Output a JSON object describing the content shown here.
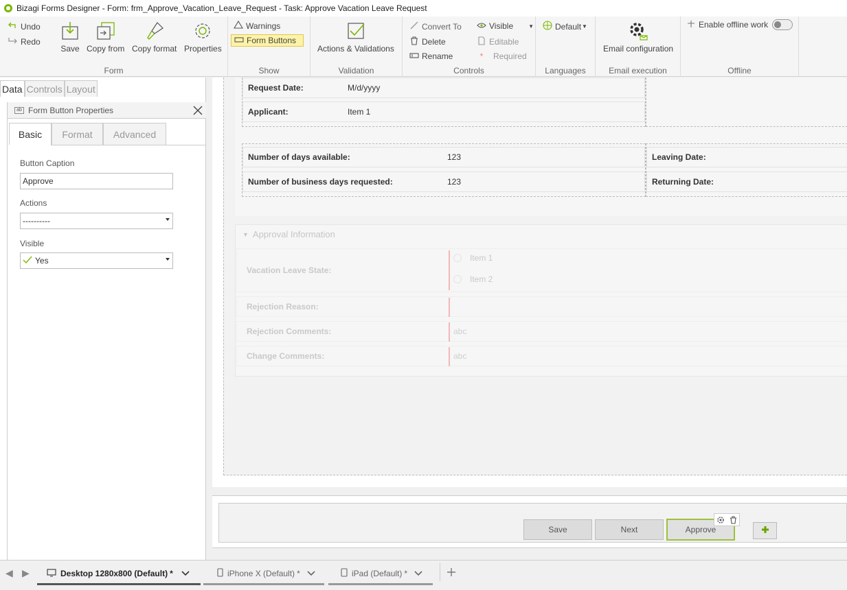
{
  "window": {
    "title": "Bizagi Forms Designer  - Form: frm_Approve_Vacation_Leave_Request - Task:  Approve Vacation Leave Request"
  },
  "ribbon": {
    "form": {
      "label": "Form",
      "undo": "Undo",
      "redo": "Redo",
      "save": "Save",
      "copy_from": "Copy from",
      "copy_format": "Copy format",
      "properties": "Properties"
    },
    "show": {
      "label": "Show",
      "warnings": "Warnings",
      "form_buttons": "Form Buttons"
    },
    "validation": {
      "label": "Validation",
      "actions": "Actions & Validations"
    },
    "controls": {
      "label": "Controls",
      "convert_to": "Convert To",
      "delete": "Delete",
      "rename": "Rename",
      "visible": "Visible",
      "editable": "Editable",
      "required": "Required"
    },
    "languages": {
      "label": "Languages",
      "default": "Default"
    },
    "email": {
      "label": "Email execution",
      "config": "Email configuration"
    },
    "offline": {
      "label": "Offline",
      "enable": "Enable offline work"
    }
  },
  "left_panel": {
    "tabs": [
      "Data",
      "Controls",
      "Layout"
    ],
    "active_tab": "Data",
    "properties_title": "Form Button Properties",
    "subtabs": [
      "Basic",
      "Format",
      "Advanced"
    ],
    "caption_label": "Button Caption",
    "caption_value": "Approve",
    "actions_label": "Actions",
    "actions_value": "----------",
    "visible_label": "Visible",
    "visible_value": "Yes"
  },
  "form": {
    "request_date_label": "Request Date:",
    "request_date_value": "M/d/yyyy",
    "applicant_label": "Applicant:",
    "applicant_value": "Item 1",
    "days_available_label": "Number of days available:",
    "days_available_value": "123",
    "business_days_label": "Number of business days requested:",
    "business_days_value": "123",
    "leaving_date_label": "Leaving Date:",
    "returning_date_label": "Returning Date:",
    "approval_section_title": "Approval Information",
    "leave_state_label": "Vacation Leave State:",
    "leave_state_options": [
      "Item 1",
      "Item 2"
    ],
    "rejection_reason_label": "Rejection Reason:",
    "rejection_comments_label": "Rejection Comments:",
    "rejection_comments_placeholder": "abc",
    "change_comments_label": "Change Comments:",
    "change_comments_placeholder": "abc"
  },
  "form_buttons": {
    "save": "Save",
    "next": "Next",
    "approve": "Approve"
  },
  "device_tabs": [
    {
      "label": "Desktop 1280x800 (Default)",
      "modified": "*"
    },
    {
      "label": "iPhone X (Default)",
      "modified": "*"
    },
    {
      "label": "iPad (Default)",
      "modified": "*"
    }
  ],
  "colors": {
    "accent": "#7ab800",
    "selected_border": "#9bc13c",
    "highlight": "#fdf3a8"
  }
}
